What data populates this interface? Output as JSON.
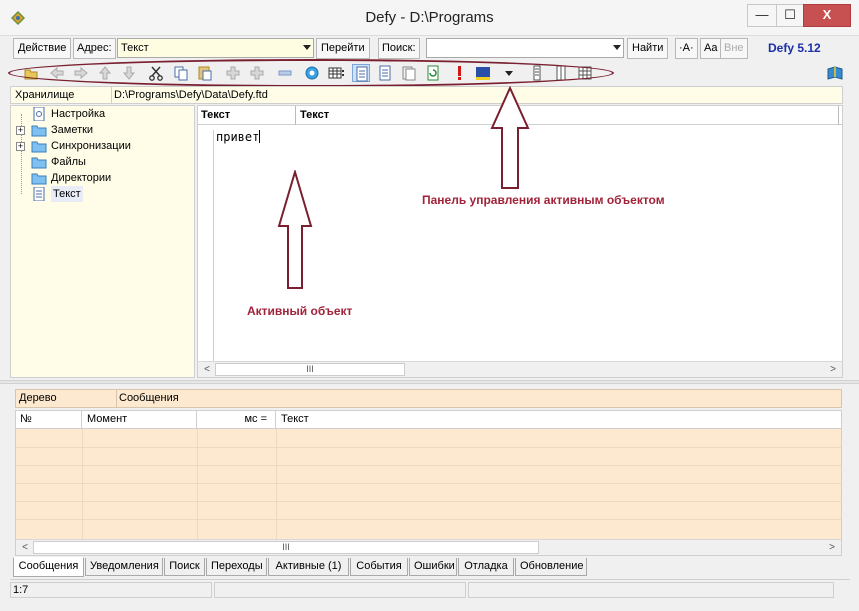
{
  "window": {
    "title": "Defy - D:\\Programs",
    "minimize": "—",
    "maximize": "☐",
    "close": "X"
  },
  "address_bar": {
    "action_button": "Действие",
    "address_label": "Адрес:",
    "address_value": "Текст",
    "go_button": "Перейти",
    "search_label": "Поиск:",
    "search_value": "",
    "find_button": "Найти",
    "font_button_a": "·A·",
    "font_button_aa": "Aa",
    "font_button_vne": "Вне",
    "version": "Defy 5.12"
  },
  "toolbar": {
    "icons": [
      "open-folder-icon",
      "back-arrow-icon",
      "forward-arrow-icon",
      "up-arrow-icon",
      "down-arrow-icon",
      "cut-icon",
      "copy-icon",
      "paste-icon",
      "add-cross-icon",
      "add-cross-icon-2",
      "minus-icon",
      "gear-icon",
      "grid-icon",
      "document-icon",
      "document-2-icon",
      "document-3-icon",
      "refresh-document-icon",
      "exclamation-icon",
      "color-icon",
      "dropdown-icon",
      "grip-icon",
      "column-icon",
      "table-icon",
      "book-icon"
    ]
  },
  "storage": {
    "label": "Хранилище",
    "path": "D:\\Programs\\Defy\\Data\\Defy.ftd"
  },
  "tree": {
    "items": [
      {
        "label": "Настройка",
        "expandable": false,
        "icon": "settings-doc-icon"
      },
      {
        "label": "Заметки",
        "expandable": true,
        "icon": "folder-icon"
      },
      {
        "label": "Синхронизации",
        "expandable": true,
        "icon": "folder-icon"
      },
      {
        "label": "Файлы",
        "expandable": false,
        "icon": "folder-icon"
      },
      {
        "label": "Директории",
        "expandable": false,
        "icon": "folder-icon"
      },
      {
        "label": "Текст",
        "expandable": false,
        "icon": "text-doc-icon"
      }
    ]
  },
  "editor": {
    "header_col1": "Текст",
    "header_col2": "Текст",
    "content": "привет",
    "scroll_grip": "III"
  },
  "annotations": {
    "panel_label": "Панель управления активным объектом",
    "object_label": "Активный объект"
  },
  "messages": {
    "tree_label": "Дерево",
    "messages_label": "Сообщения",
    "columns": [
      "№",
      "Момент",
      "мс =",
      "Текст"
    ],
    "scroll_grip": "III"
  },
  "tabs": [
    {
      "label": "Сообщения",
      "active": true
    },
    {
      "label": "Уведомления",
      "active": false
    },
    {
      "label": "Поиск",
      "active": false
    },
    {
      "label": "Переходы",
      "active": false
    },
    {
      "label": "Активные (1)",
      "active": false
    },
    {
      "label": "События",
      "active": false
    },
    {
      "label": "Ошибки",
      "active": false
    },
    {
      "label": "Отладка",
      "active": false
    },
    {
      "label": "Обновление",
      "active": false
    }
  ],
  "status": {
    "position": "1:7"
  },
  "colors": {
    "annotation": "#a1233a",
    "panel_bg": "#fffde8",
    "messages_bg": "#fde9cf",
    "version_text": "#1a2fa8"
  }
}
